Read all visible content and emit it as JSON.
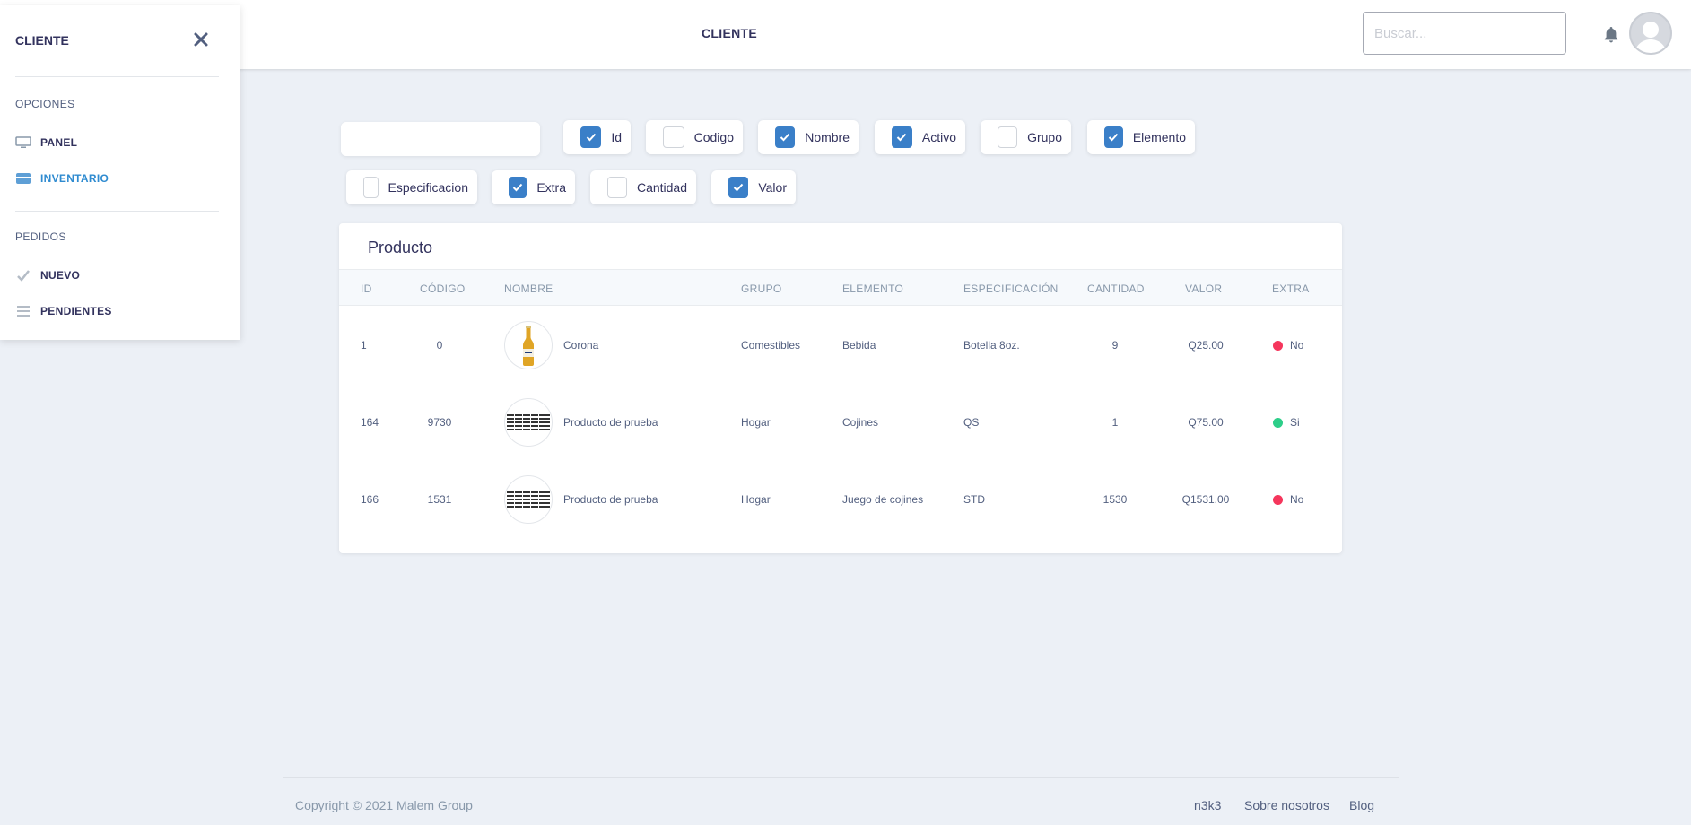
{
  "header": {
    "title": "CLIENTE",
    "search_placeholder": "Buscar..."
  },
  "sidebar": {
    "title": "CLIENTE",
    "sections": [
      {
        "heading": "OPCIONES",
        "items": [
          {
            "label": "PANEL",
            "icon": "monitor-icon",
            "active": false
          },
          {
            "label": "INVENTARIO",
            "icon": "store-icon",
            "active": true
          }
        ]
      },
      {
        "heading": "PEDIDOS",
        "items": [
          {
            "label": "NUEVO",
            "icon": "check-icon",
            "active": false
          },
          {
            "label": "PENDIENTES",
            "icon": "list-icon",
            "active": false
          }
        ]
      }
    ]
  },
  "filters": {
    "search_value": "",
    "columns": [
      {
        "label": "Id",
        "checked": true
      },
      {
        "label": "Codigo",
        "checked": false
      },
      {
        "label": "Nombre",
        "checked": true
      },
      {
        "label": "Activo",
        "checked": true
      },
      {
        "label": "Grupo",
        "checked": false
      },
      {
        "label": "Elemento",
        "checked": true
      },
      {
        "label": "Especificacion",
        "checked": false
      },
      {
        "label": "Extra",
        "checked": true
      },
      {
        "label": "Cantidad",
        "checked": false
      },
      {
        "label": "Valor",
        "checked": true
      }
    ]
  },
  "table": {
    "title": "Producto",
    "headers": [
      "ID",
      "CÓDIGO",
      "NOMBRE",
      "GRUPO",
      "ELEMENTO",
      "ESPECIFICACIÓN",
      "CANTIDAD",
      "VALOR",
      "EXTRA"
    ],
    "rows": [
      {
        "id": "1",
        "codigo": "0",
        "nombre": "Corona",
        "image": "bottle-image",
        "grupo": "Comestibles",
        "elemento": "Bebida",
        "especificacion": "Botella 8oz.",
        "cantidad": "9",
        "valor": "Q25.00",
        "extra": "No",
        "extra_color": "#f5365c"
      },
      {
        "id": "164",
        "codigo": "9730",
        "nombre": "Producto de prueba",
        "image": "barcode-image",
        "grupo": "Hogar",
        "elemento": "Cojines",
        "especificacion": "QS",
        "cantidad": "1",
        "valor": "Q75.00",
        "extra": "Si",
        "extra_color": "#2dce89"
      },
      {
        "id": "166",
        "codigo": "1531",
        "nombre": "Producto de prueba",
        "image": "barcode-image",
        "grupo": "Hogar",
        "elemento": "Juego de cojines",
        "especificacion": "STD",
        "cantidad": "1530",
        "valor": "Q1531.00",
        "extra": "No",
        "extra_color": "#f5365c"
      }
    ]
  },
  "footer": {
    "copyright": "Copyright © 2021 Malem Group",
    "links": [
      "n3k3",
      "Sobre nosotros",
      "Blog"
    ]
  },
  "colors": {
    "accent": "#3a7fc8",
    "active_link": "#2f8bd0",
    "background": "#ecf0f6"
  }
}
